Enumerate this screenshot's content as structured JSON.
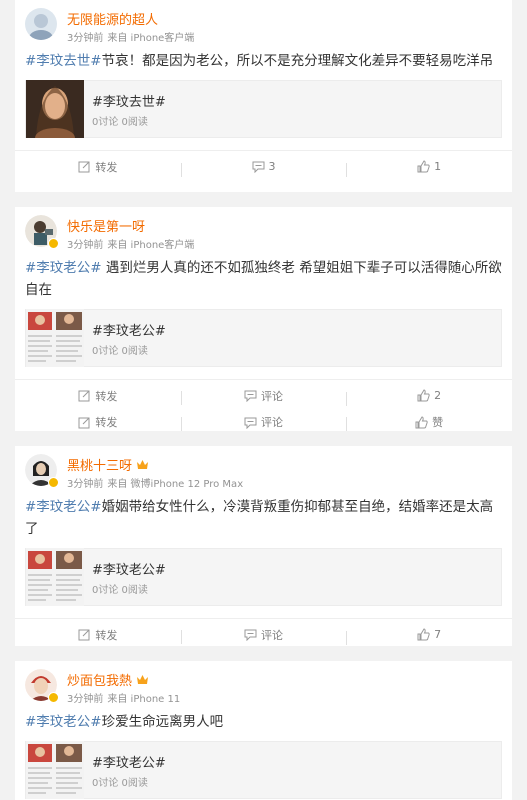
{
  "posts": [
    {
      "username": "无限能源的超人",
      "time": "3分钟前",
      "source": "来自 iPhone客户端",
      "topic": "#李玟去世#",
      "text": "节哀！都是因为老公，所以不是充分理解文化差异不要轻易吃洋吊",
      "ref_title": "#李玟去世#",
      "ref_stats": "0讨论 0阅读",
      "forward": "转发",
      "comment": "3",
      "like": "1"
    },
    {
      "username": "快乐是第一呀",
      "time": "3分钟前",
      "source": "来自 iPhone客户端",
      "topic": "#李玟老公#",
      "text": " 遇到烂男人真的还不如孤独终老 希望姐姐下辈子可以活得随心所欲 自在",
      "ref_title": "#李玟老公#",
      "ref_stats": "0讨论 0阅读",
      "forward": "转发",
      "comment": "评论",
      "like": "2",
      "forward2": "转发",
      "comment2": "评论",
      "like2": "赞"
    },
    {
      "username": "黑桃十三呀",
      "time": "3分钟前",
      "source": "来自 微博iPhone 12 Pro Max",
      "topic": "#李玟老公#",
      "text": "婚姻带给女性什么，冷漠背叛重伤抑郁甚至自绝，结婚率还是太高了",
      "ref_title": "#李玟老公#",
      "ref_stats": "0讨论 0阅读",
      "forward": "转发",
      "comment": "评论",
      "like": "7"
    },
    {
      "username": "炒面包我熱",
      "time": "3分钟前",
      "source": "来自 iPhone 11",
      "topic": "#李玟老公#",
      "text": "珍爱生命远离男人吧",
      "ref_title": "#李玟老公#",
      "ref_stats": "0讨论 0阅读"
    }
  ],
  "colors": {
    "username": "#f36b00",
    "topic": "#507daf",
    "meta": "#939393",
    "background": "#f2f2f2"
  },
  "icons": {
    "forward": "share-icon",
    "comment": "comment-icon",
    "like": "thumb-up-icon"
  }
}
